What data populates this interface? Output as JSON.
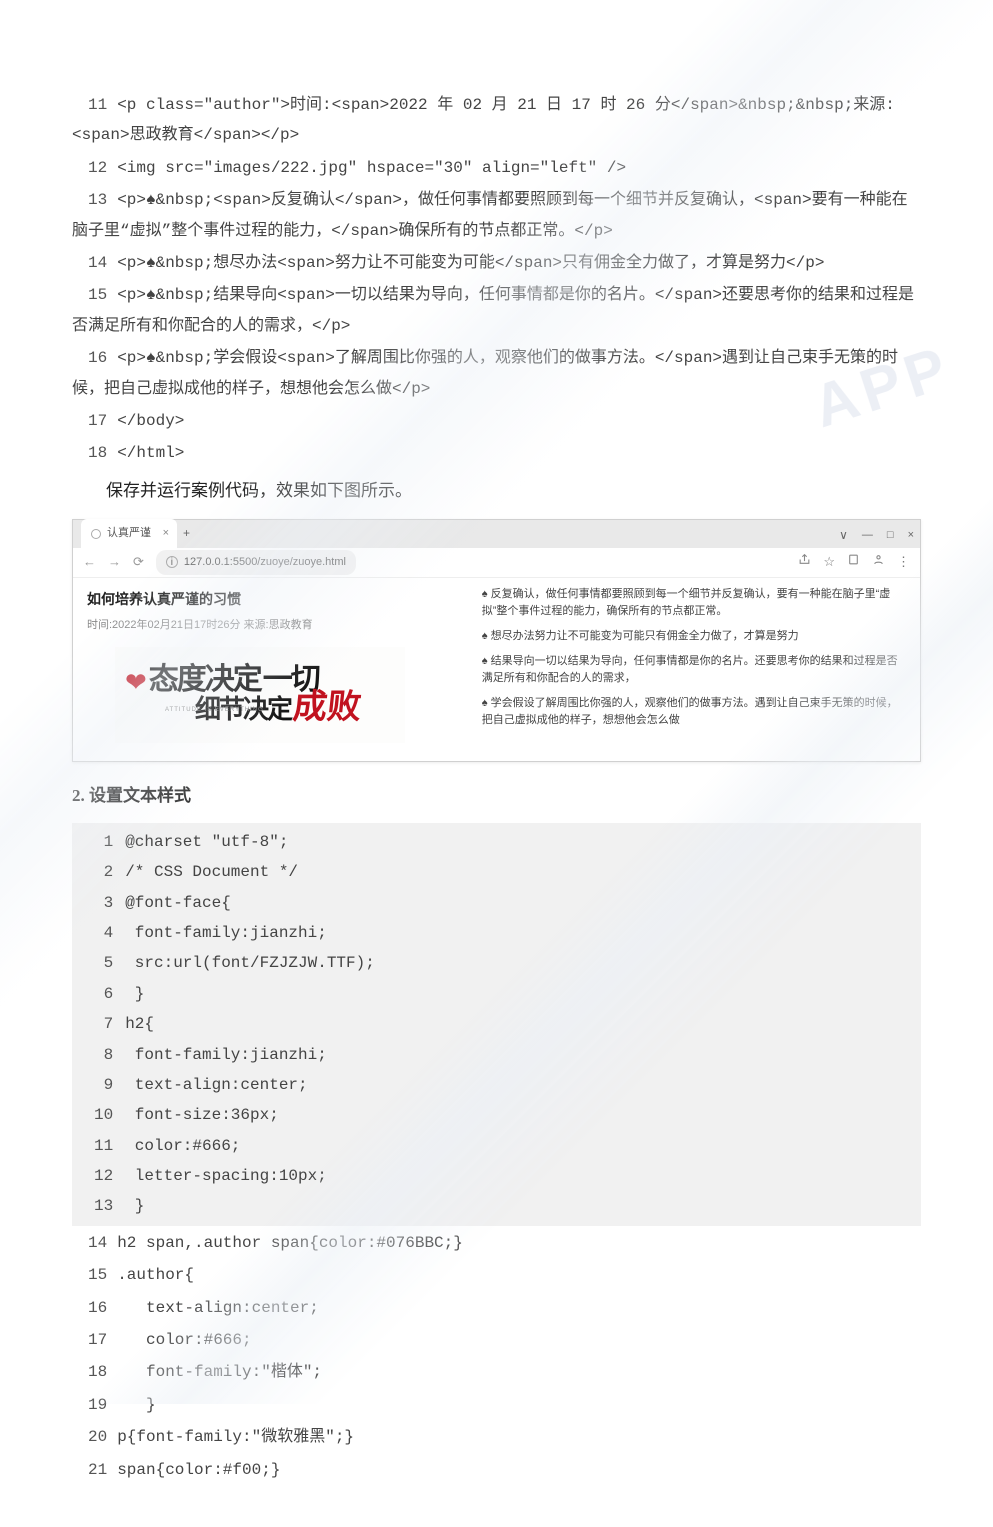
{
  "watermark_text": "APP",
  "code_lines_html_section": [
    {
      "n": "11",
      "t": "<p class=\"author\">时间:<span>2022 年 02 月 21 日 17 时 26 分</span>&nbsp;&nbsp;来源:<span>思政教育</span></p>"
    },
    {
      "n": "12",
      "t": "<img src=\"images/222.jpg\" hspace=\"30\" align=\"left\" />"
    },
    {
      "n": "13",
      "t": "<p>♠&nbsp;<span>反复确认</span>，做任何事情都要照顾到每一个细节并反复确认，<span>要有一种能在脑子里“虚拟”整个事件过程的能力，</span>确保所有的节点都正常。</p>"
    },
    {
      "n": "14",
      "t": "<p>♠&nbsp;想尽办法<span>努力让不可能变为可能</span>只有佣金全力做了，才算是努力</p>"
    },
    {
      "n": "15",
      "t": "<p>♠&nbsp;结果导向<span>一切以结果为导向，任何事情都是你的名片。</span>还要思考你的结果和过程是否满足所有和你配合的人的需求，</p>"
    },
    {
      "n": "16",
      "t": "<p>♠&nbsp;学会假设<span>了解周围比你强的人，观察他们的做事方法。</span>遇到让自己束手无策的时候，把自己虚拟成他的样子，想想他会怎么做</p>"
    },
    {
      "n": "17",
      "t": "</body>"
    },
    {
      "n": "18",
      "t": "</html>"
    }
  ],
  "narration_after_code": "保存并运行案例代码，效果如下图所示。",
  "preview": {
    "tab_title": "认真严谨",
    "url": "127.0.0.1:5500/zuoye/zuoye.html",
    "win_btns": {
      "min": "—",
      "max": "□",
      "close": "×"
    },
    "plus": "+",
    "tab_close": "×",
    "nav_chevron": "∨",
    "heading": "如何培养认真严谨的习惯",
    "meta": "时间:2022年02月21日17时26分  来源:思政教育",
    "banner": {
      "row1_black": "态度决定",
      "row1_trail": "一切",
      "row2_black": "细节决定",
      "row2_red": "成败",
      "mini": "ATTITUDE IS EVERYTHING"
    },
    "bullets": [
      "♠ 反复确认，做任何事情都要照顾到每一个细节并反复确认，要有一种能在脑子里“虚拟”整个事件过程的能力，确保所有的节点都正常。",
      "♠ 想尽办法努力让不可能变为可能只有佣金全力做了，才算是努力",
      "♠ 结果导向一切以结果为导向，任何事情都是你的名片。还要思考你的结果和过程是否满足所有和你配合的人的需求，",
      "♠ 学会假设了解周围比你强的人，观察他们的做事方法。遇到让自己束手无策的时候，把自己虚拟成他的样子，想想他会怎么做"
    ]
  },
  "section2_title": "2. 设置文本样式",
  "grey_code_lines": [
    {
      "n": "1",
      "t": "@charset \"utf-8\";"
    },
    {
      "n": "2",
      "t": "/* CSS Document */"
    },
    {
      "n": "3",
      "t": "@font-face{"
    },
    {
      "n": "4",
      "t": "    font-family:jianzhi;"
    },
    {
      "n": "5",
      "t": "    src:url(font/FZJZJW.TTF);"
    },
    {
      "n": "6",
      "t": "    }"
    },
    {
      "n": "7",
      "t": "h2{"
    },
    {
      "n": "8",
      "t": "    font-family:jianzhi;"
    },
    {
      "n": "9",
      "t": "    text-align:center;"
    },
    {
      "n": "10",
      "t": "    font-size:36px;"
    },
    {
      "n": "11",
      "t": "    color:#666;"
    },
    {
      "n": "12",
      "t": "    letter-spacing:10px;"
    },
    {
      "n": "13",
      "t": "    }"
    }
  ],
  "plain_code_lines_after_grey": [
    {
      "n": "14",
      "t": "h2 span,.author span{color:#076BBC;}"
    },
    {
      "n": "15",
      "t": ".author{"
    },
    {
      "n": "16",
      "t": "   text-align:center;"
    },
    {
      "n": "17",
      "t": "   color:#666;"
    },
    {
      "n": "18",
      "t": "   font-family:\"楷体\";"
    },
    {
      "n": "19",
      "t": "   }"
    },
    {
      "n": "20",
      "t": "p{font-family:\"微软雅黑\";}"
    },
    {
      "n": "21",
      "t": "span{color:#f00;}"
    }
  ]
}
